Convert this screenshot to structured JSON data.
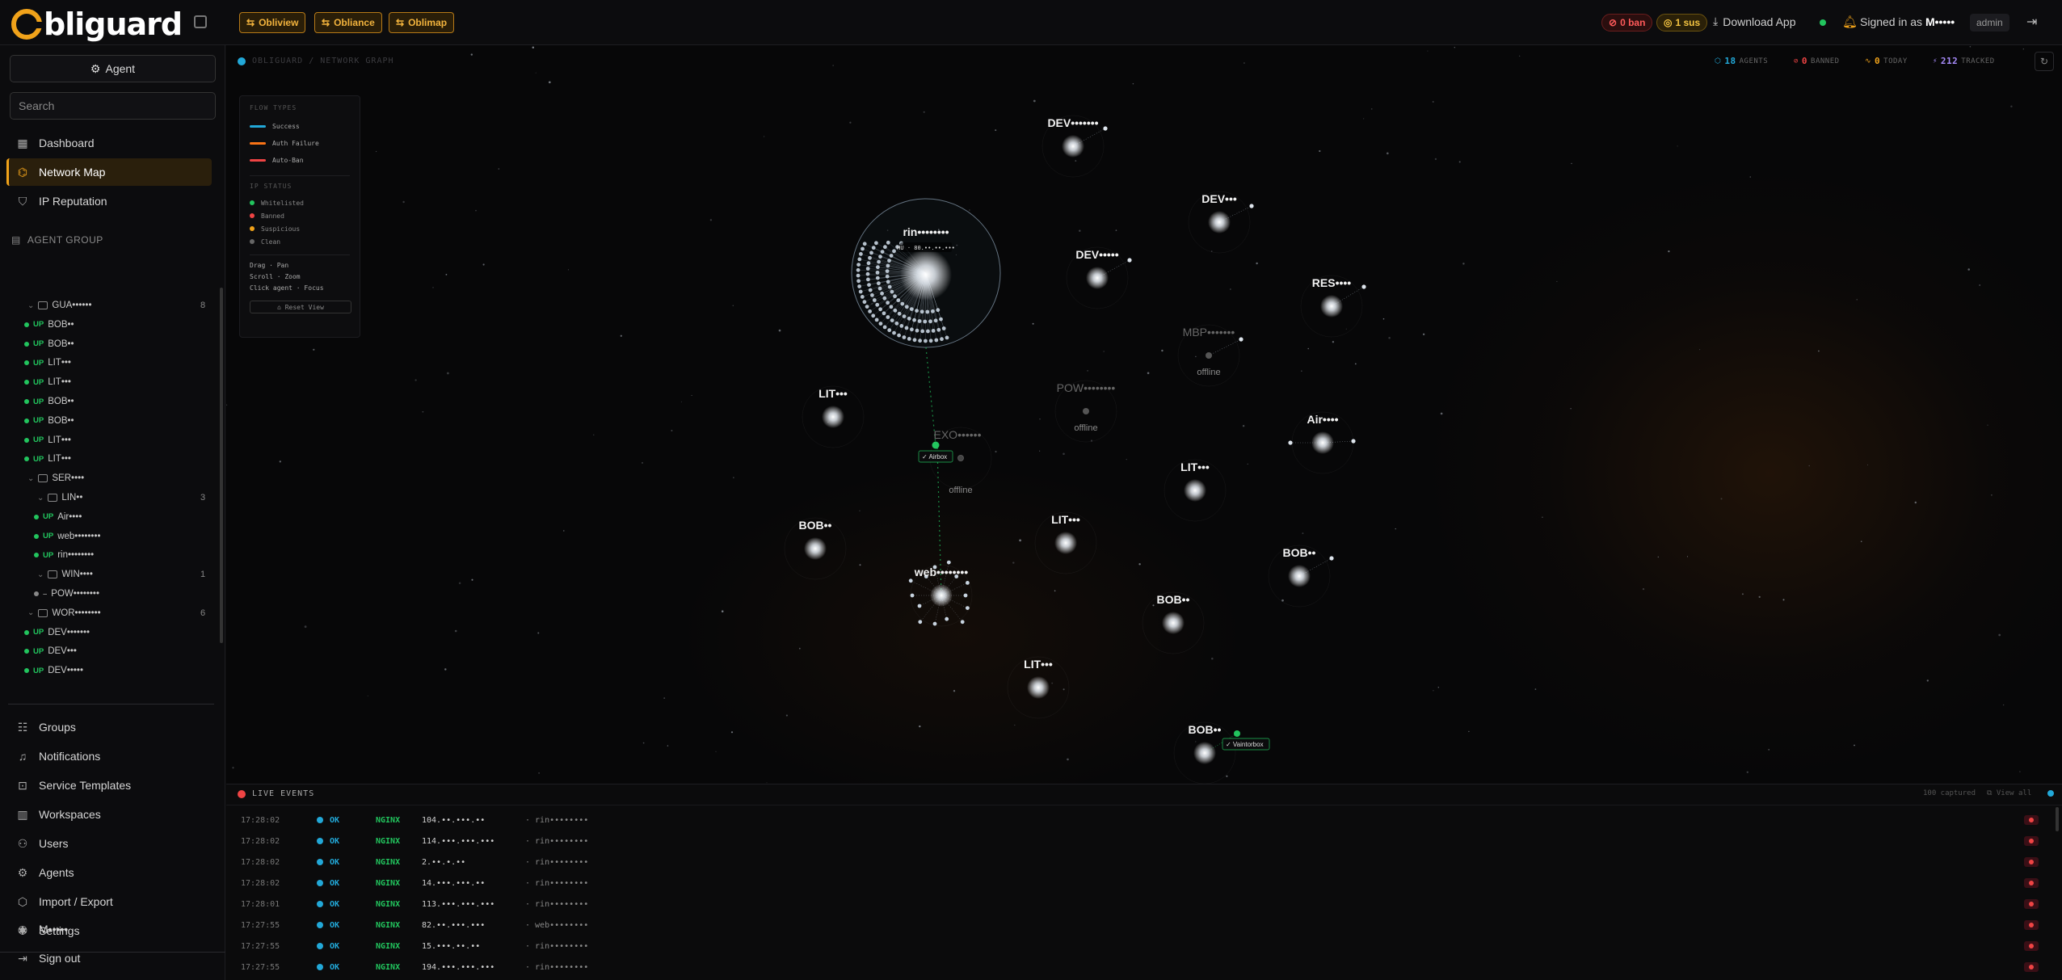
{
  "app": {
    "logo_text": "bliguard",
    "apps": [
      {
        "label": "Obliview",
        "icon": "arrows-icon"
      },
      {
        "label": "Obliance",
        "icon": "arrows-icon"
      },
      {
        "label": "Oblimap",
        "icon": "arrows-icon"
      }
    ],
    "ban_pill": "0 ban",
    "sus_pill": "1 sus",
    "download_label": "Download App",
    "signed_prefix": "Signed in as",
    "signed_user": "M•••••",
    "role": "admin",
    "colors": {
      "accent": "#f0a21a",
      "success": "#22a8d8",
      "auth_failure": "#f97316",
      "auto_ban": "#ef4444",
      "up": "#22c55e"
    }
  },
  "sidebar": {
    "agent_button": "Agent",
    "search_placeholder": "Search",
    "nav": [
      {
        "label": "Dashboard",
        "icon": "dashboard-icon",
        "active": false
      },
      {
        "label": "Network Map",
        "icon": "network-icon",
        "active": true
      },
      {
        "label": "IP Reputation",
        "icon": "shield-icon",
        "active": false
      }
    ],
    "agent_group_heading": "AGENT GROUP",
    "tree": [
      {
        "type": "group",
        "level": 0,
        "label": "GUA••••••",
        "count": "8"
      },
      {
        "type": "agent",
        "level": 0,
        "status": "UP",
        "label": "BOB••"
      },
      {
        "type": "agent",
        "level": 0,
        "status": "UP",
        "label": "BOB••"
      },
      {
        "type": "agent",
        "level": 0,
        "status": "UP",
        "label": "LIT•••"
      },
      {
        "type": "agent",
        "level": 0,
        "status": "UP",
        "label": "LIT•••"
      },
      {
        "type": "agent",
        "level": 0,
        "status": "UP",
        "label": "BOB••"
      },
      {
        "type": "agent",
        "level": 0,
        "status": "UP",
        "label": "BOB••"
      },
      {
        "type": "agent",
        "level": 0,
        "status": "UP",
        "label": "LIT•••"
      },
      {
        "type": "agent",
        "level": 0,
        "status": "UP",
        "label": "LIT•••"
      },
      {
        "type": "group",
        "level": 0,
        "label": "SER••••",
        "count": ""
      },
      {
        "type": "group",
        "level": 1,
        "label": "LIN••",
        "count": "3"
      },
      {
        "type": "agent",
        "level": 1,
        "status": "UP",
        "label": "Air••••"
      },
      {
        "type": "agent",
        "level": 1,
        "status": "UP",
        "label": "web••••••••"
      },
      {
        "type": "agent",
        "level": 1,
        "status": "UP",
        "label": "rin••••••••"
      },
      {
        "type": "group",
        "level": 1,
        "label": "WIN••••",
        "count": "1"
      },
      {
        "type": "agent",
        "level": 1,
        "status": "–",
        "label": "POW••••••••"
      },
      {
        "type": "group",
        "level": 0,
        "label": "WOR••••••••",
        "count": "6"
      },
      {
        "type": "agent",
        "level": 0,
        "status": "UP",
        "label": "DEV•••••••"
      },
      {
        "type": "agent",
        "level": 0,
        "status": "UP",
        "label": "DEV•••"
      },
      {
        "type": "agent",
        "level": 0,
        "status": "UP",
        "label": "DEV•••••"
      }
    ],
    "nav_bottom": [
      {
        "label": "Groups",
        "icon": "groups-icon"
      },
      {
        "label": "Notifications",
        "icon": "bell-icon"
      },
      {
        "label": "Service Templates",
        "icon": "template-icon"
      },
      {
        "label": "Workspaces",
        "icon": "workspace-icon"
      },
      {
        "label": "Users",
        "icon": "users-icon"
      },
      {
        "label": "Agents",
        "icon": "gear-icon"
      },
      {
        "label": "Import / Export",
        "icon": "package-icon"
      },
      {
        "label": "Settings",
        "icon": "settings-icon"
      }
    ],
    "user_label": "M•••••",
    "signout_label": "Sign out"
  },
  "graph": {
    "breadcrumb": "OBLIGUARD / NETWORK GRAPH",
    "stats": [
      {
        "value": "18",
        "label": "AGENTS",
        "color": "#22a8d8"
      },
      {
        "value": "0",
        "label": "BANNED",
        "color": "#ef4444"
      },
      {
        "value": "0",
        "label": "TODAY",
        "color": "#f0a21a"
      },
      {
        "value": "212",
        "label": "TRACKED",
        "color": "#a78bfa"
      }
    ],
    "legend": {
      "flow_heading": "FLOW TYPES",
      "flows": [
        {
          "label": "Success",
          "color": "#22a8d8"
        },
        {
          "label": "Auth Failure",
          "color": "#f97316"
        },
        {
          "label": "Auto-Ban",
          "color": "#ef4444"
        }
      ],
      "ip_heading": "IP STATUS",
      "ip_status": [
        {
          "label": "Whitelisted",
          "color": "#22c55e"
        },
        {
          "label": "Banned",
          "color": "#ef4444"
        },
        {
          "label": "Suspicious",
          "color": "#f0a21a"
        },
        {
          "label": "Clean",
          "color": "#666666"
        }
      ],
      "help": [
        "Drag · Pan",
        "Scroll · Zoom",
        "Click agent · Focus"
      ],
      "reset_label": "⌂ Reset View"
    },
    "nodes": [
      {
        "label": "DEV•••••••",
        "offline": false
      },
      {
        "label": "DEV•••",
        "offline": false
      },
      {
        "label": "DEV•••••",
        "offline": false
      },
      {
        "label": "RES••••",
        "offline": false
      },
      {
        "label": "MBP•••••••",
        "offline": true
      },
      {
        "label": "POW••••••••",
        "offline": true
      },
      {
        "label": "EXO••••••",
        "offline": true
      },
      {
        "label": "rin••••••••",
        "offline": false
      },
      {
        "label": "LIT•••",
        "offline": false
      },
      {
        "label": "Air••••",
        "offline": false
      },
      {
        "label": "LIT•••",
        "offline": false
      },
      {
        "label": "BOB••",
        "offline": false
      },
      {
        "label": "LIT•••",
        "offline": false
      },
      {
        "label": "BOB••",
        "offline": false
      },
      {
        "label": "web••••••••",
        "offline": false
      },
      {
        "label": "BOB••",
        "offline": false
      },
      {
        "label": "LIT•••",
        "offline": false
      },
      {
        "label": "BOB••",
        "offline": false
      }
    ],
    "offline_text": "offline",
    "rin_sublabel": "HU · 80.••.••.•••",
    "tags": [
      "✓ Airbox",
      "✓ Vaintorbox"
    ]
  },
  "events": {
    "heading": "LIVE EVENTS",
    "captured": "100 captured",
    "view_all": "View all",
    "rows": [
      {
        "time": "17:28:02",
        "result": "OK",
        "service": "NGINX",
        "ip": "104.••.•••.••",
        "agent": "rin••••••••"
      },
      {
        "time": "17:28:02",
        "result": "OK",
        "service": "NGINX",
        "ip": "114.•••.•••.•••",
        "agent": "rin••••••••"
      },
      {
        "time": "17:28:02",
        "result": "OK",
        "service": "NGINX",
        "ip": "2.••.•.••",
        "agent": "rin••••••••"
      },
      {
        "time": "17:28:02",
        "result": "OK",
        "service": "NGINX",
        "ip": "14.•••.•••.••",
        "agent": "rin••••••••"
      },
      {
        "time": "17:28:01",
        "result": "OK",
        "service": "NGINX",
        "ip": "113.•••.•••.•••",
        "agent": "rin••••••••"
      },
      {
        "time": "17:27:55",
        "result": "OK",
        "service": "NGINX",
        "ip": "82.••.•••.•••",
        "agent": "web••••••••"
      },
      {
        "time": "17:27:55",
        "result": "OK",
        "service": "NGINX",
        "ip": "15.•••.••.••",
        "agent": "rin••••••••"
      },
      {
        "time": "17:27:55",
        "result": "OK",
        "service": "NGINX",
        "ip": "194.•••.•••.•••",
        "agent": "rin••••••••"
      }
    ]
  }
}
